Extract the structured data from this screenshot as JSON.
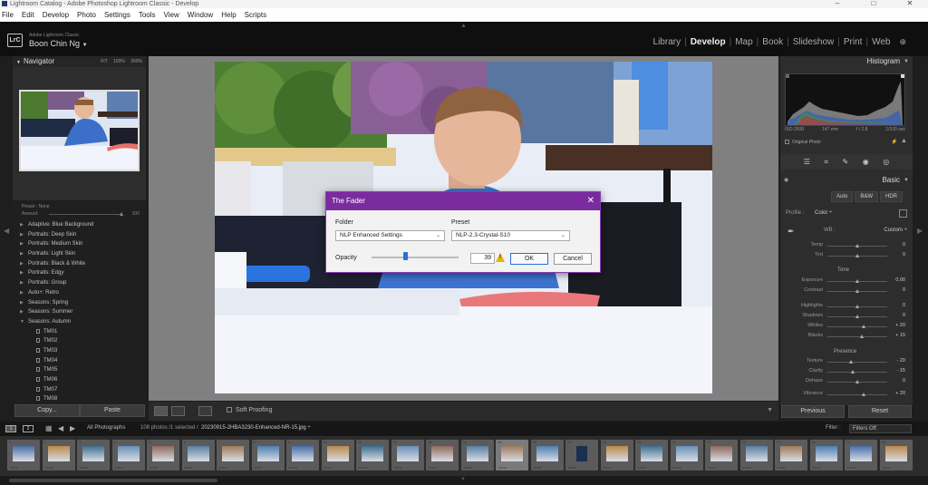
{
  "window": {
    "title": "Lightroom Catalog - Adobe Photoshop Lightroom Classic - Develop"
  },
  "menu": [
    "File",
    "Edit",
    "Develop",
    "Photo",
    "Settings",
    "Tools",
    "View",
    "Window",
    "Help",
    "Scripts"
  ],
  "header": {
    "logo": "LrC",
    "brand": "Adobe Lightroom Classic",
    "user": "Boon Chin Ng",
    "modules": [
      "Library",
      "Develop",
      "Map",
      "Book",
      "Slideshow",
      "Print",
      "Web"
    ],
    "active_module": "Develop"
  },
  "navigator": {
    "title": "Navigator",
    "zoom_options": [
      "FIT",
      "100%",
      "300%"
    ]
  },
  "presets": {
    "header": "Preset : None",
    "amount_label": "Amount",
    "amount_value": "100",
    "items": [
      {
        "label": "Adaptive: Blue Background",
        "child": false,
        "open": false
      },
      {
        "label": "Portraits: Deep Skin",
        "child": false,
        "open": false
      },
      {
        "label": "Portraits: Medium Skin",
        "child": false,
        "open": false
      },
      {
        "label": "Portraits: Light Skin",
        "child": false,
        "open": false
      },
      {
        "label": "Portraits: Black & White",
        "child": false,
        "open": false
      },
      {
        "label": "Portraits: Edgy",
        "child": false,
        "open": false
      },
      {
        "label": "Portraits: Group",
        "child": false,
        "open": false
      },
      {
        "label": "Auto+: Retro",
        "child": false,
        "open": false
      },
      {
        "label": "Seasons: Spring",
        "child": false,
        "open": false
      },
      {
        "label": "Seasons: Summer",
        "child": false,
        "open": false
      },
      {
        "label": "Seasons: Autumn",
        "child": false,
        "open": true
      },
      {
        "label": "TM01",
        "child": true
      },
      {
        "label": "TM02",
        "child": true
      },
      {
        "label": "TM03",
        "child": true
      },
      {
        "label": "TM04",
        "child": true
      },
      {
        "label": "TM05",
        "child": true
      },
      {
        "label": "TM06",
        "child": true
      },
      {
        "label": "TM07",
        "child": true
      },
      {
        "label": "TM08",
        "child": true
      }
    ]
  },
  "left_buttons": {
    "copy": "Copy...",
    "paste": "Paste"
  },
  "toolbar": {
    "soft_proofing": "Soft Proofing"
  },
  "histogram": {
    "title": "Histogram",
    "iso": "ISO 2500",
    "focal": "147 mm",
    "aperture": "f / 2.8",
    "shutter": "1/100 sec",
    "original_photo": "Original Photo"
  },
  "basic": {
    "title": "Basic",
    "modes": [
      "Auto",
      "B&W",
      "HDR"
    ],
    "profile_label": "Profile :",
    "profile_value": "Color ÷",
    "wb_label": "WB :",
    "wb_value": "Custom ÷",
    "sliders_wb": [
      {
        "label": "Temp",
        "value": "0",
        "pos": 0.5
      },
      {
        "label": "Tint",
        "value": "0",
        "pos": 0.5
      }
    ],
    "tone_title": "Tone",
    "sliders_tone": [
      {
        "label": "Exposure",
        "value": "0.00",
        "pos": 0.5
      },
      {
        "label": "Contrast",
        "value": "0",
        "pos": 0.5
      },
      {
        "label": "Highlights",
        "value": "0",
        "pos": 0.5
      },
      {
        "label": "Shadows",
        "value": "0",
        "pos": 0.5
      },
      {
        "label": "Whites",
        "value": "+ 20",
        "pos": 0.6
      },
      {
        "label": "Blacks",
        "value": "+ 15",
        "pos": 0.575
      }
    ],
    "presence_title": "Presence",
    "sliders_presence": [
      {
        "label": "Texture",
        "value": "- 20",
        "pos": 0.4
      },
      {
        "label": "Clarity",
        "value": "- 15",
        "pos": 0.425
      },
      {
        "label": "Dehaze",
        "value": "0",
        "pos": 0.5
      },
      {
        "label": "Vibrance",
        "value": "+ 20",
        "pos": 0.6
      }
    ]
  },
  "right_buttons": {
    "previous": "Previous",
    "reset": "Reset"
  },
  "filmbar": {
    "monitor1": "1",
    "monitor2": "2",
    "source": "All Photographs",
    "count": "108 photos /1 selected /",
    "file": "20230915-2HBA3230-Enhanced-NR-15.jpg ÷",
    "filter_label": "Filter :",
    "filter_value": "Filters Off"
  },
  "filmstrip": {
    "selected_index": 14,
    "thumbs": [
      "1",
      "2",
      "3",
      "4",
      "5",
      "6",
      "7",
      "8",
      "9",
      "10",
      "11",
      "12",
      "13",
      "14",
      "15",
      "16",
      "17",
      "18",
      "19",
      "20",
      "21",
      "22",
      "23",
      "24",
      "25",
      "26"
    ]
  },
  "dialog": {
    "title": "The Fader",
    "folder_label": "Folder",
    "folder_value": "NLP Enhanced Settings",
    "preset_label": "Preset",
    "preset_value": "NLP-2.3-Crystal-S10",
    "opacity_label": "Opacity",
    "opacity_value": "39",
    "opacity_level": 0.39,
    "ok": "OK",
    "cancel": "Cancel"
  },
  "colors": {
    "dialog_title_bg": "#7a2c9f",
    "slider_knob": "#2a6fd6",
    "warning": "#e8b400"
  }
}
